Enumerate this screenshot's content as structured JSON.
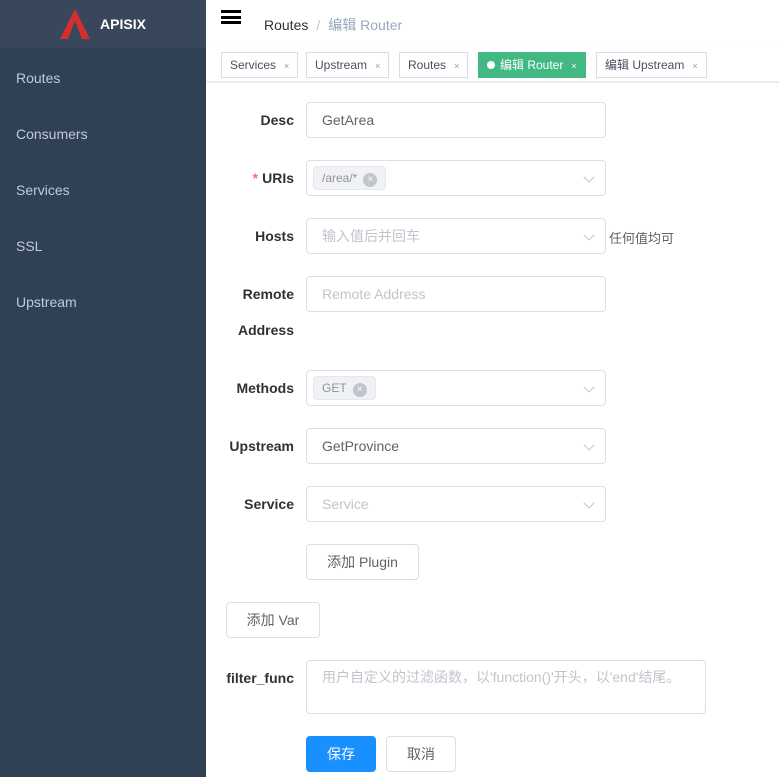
{
  "app": {
    "name": "APISIX"
  },
  "sidebar": {
    "items": [
      {
        "label": "Routes"
      },
      {
        "label": "Consumers"
      },
      {
        "label": "Services"
      },
      {
        "label": "SSL"
      },
      {
        "label": "Upstream"
      }
    ]
  },
  "breadcrumb": {
    "parent": "Routes",
    "separator": "/",
    "current": "编辑 Router"
  },
  "tags": [
    {
      "label": "Services"
    },
    {
      "label": "Upstream"
    },
    {
      "label": "Routes"
    },
    {
      "label": "编辑 Router"
    },
    {
      "label": "编辑 Upstream"
    }
  ],
  "tag_close": "×",
  "form": {
    "desc": {
      "label": "Desc",
      "value": "GetArea"
    },
    "uris": {
      "label": "URIs",
      "required": "*",
      "chips": [
        "/area/*"
      ]
    },
    "hosts": {
      "label": "Hosts",
      "placeholder": "输入值后并回车",
      "hint": "任何值均可"
    },
    "remote": {
      "label1": "Remote",
      "label2": "Address",
      "placeholder": "Remote Address"
    },
    "methods": {
      "label": "Methods",
      "chips": [
        "GET"
      ]
    },
    "upstream": {
      "label": "Upstream",
      "value": "GetProvince"
    },
    "service": {
      "label": "Service",
      "placeholder": "Service"
    },
    "add_plugin": "添加 Plugin",
    "add_var": "添加 Var",
    "filter_func": {
      "label": "filter_func",
      "placeholder": "用户自定义的过滤函数，以'function()'开头，以'end'结尾。"
    },
    "save": "保存",
    "cancel": "取消"
  },
  "colors": {
    "sidebar": "#304156",
    "active_tag": "#42b983",
    "primary": "#1890ff"
  }
}
